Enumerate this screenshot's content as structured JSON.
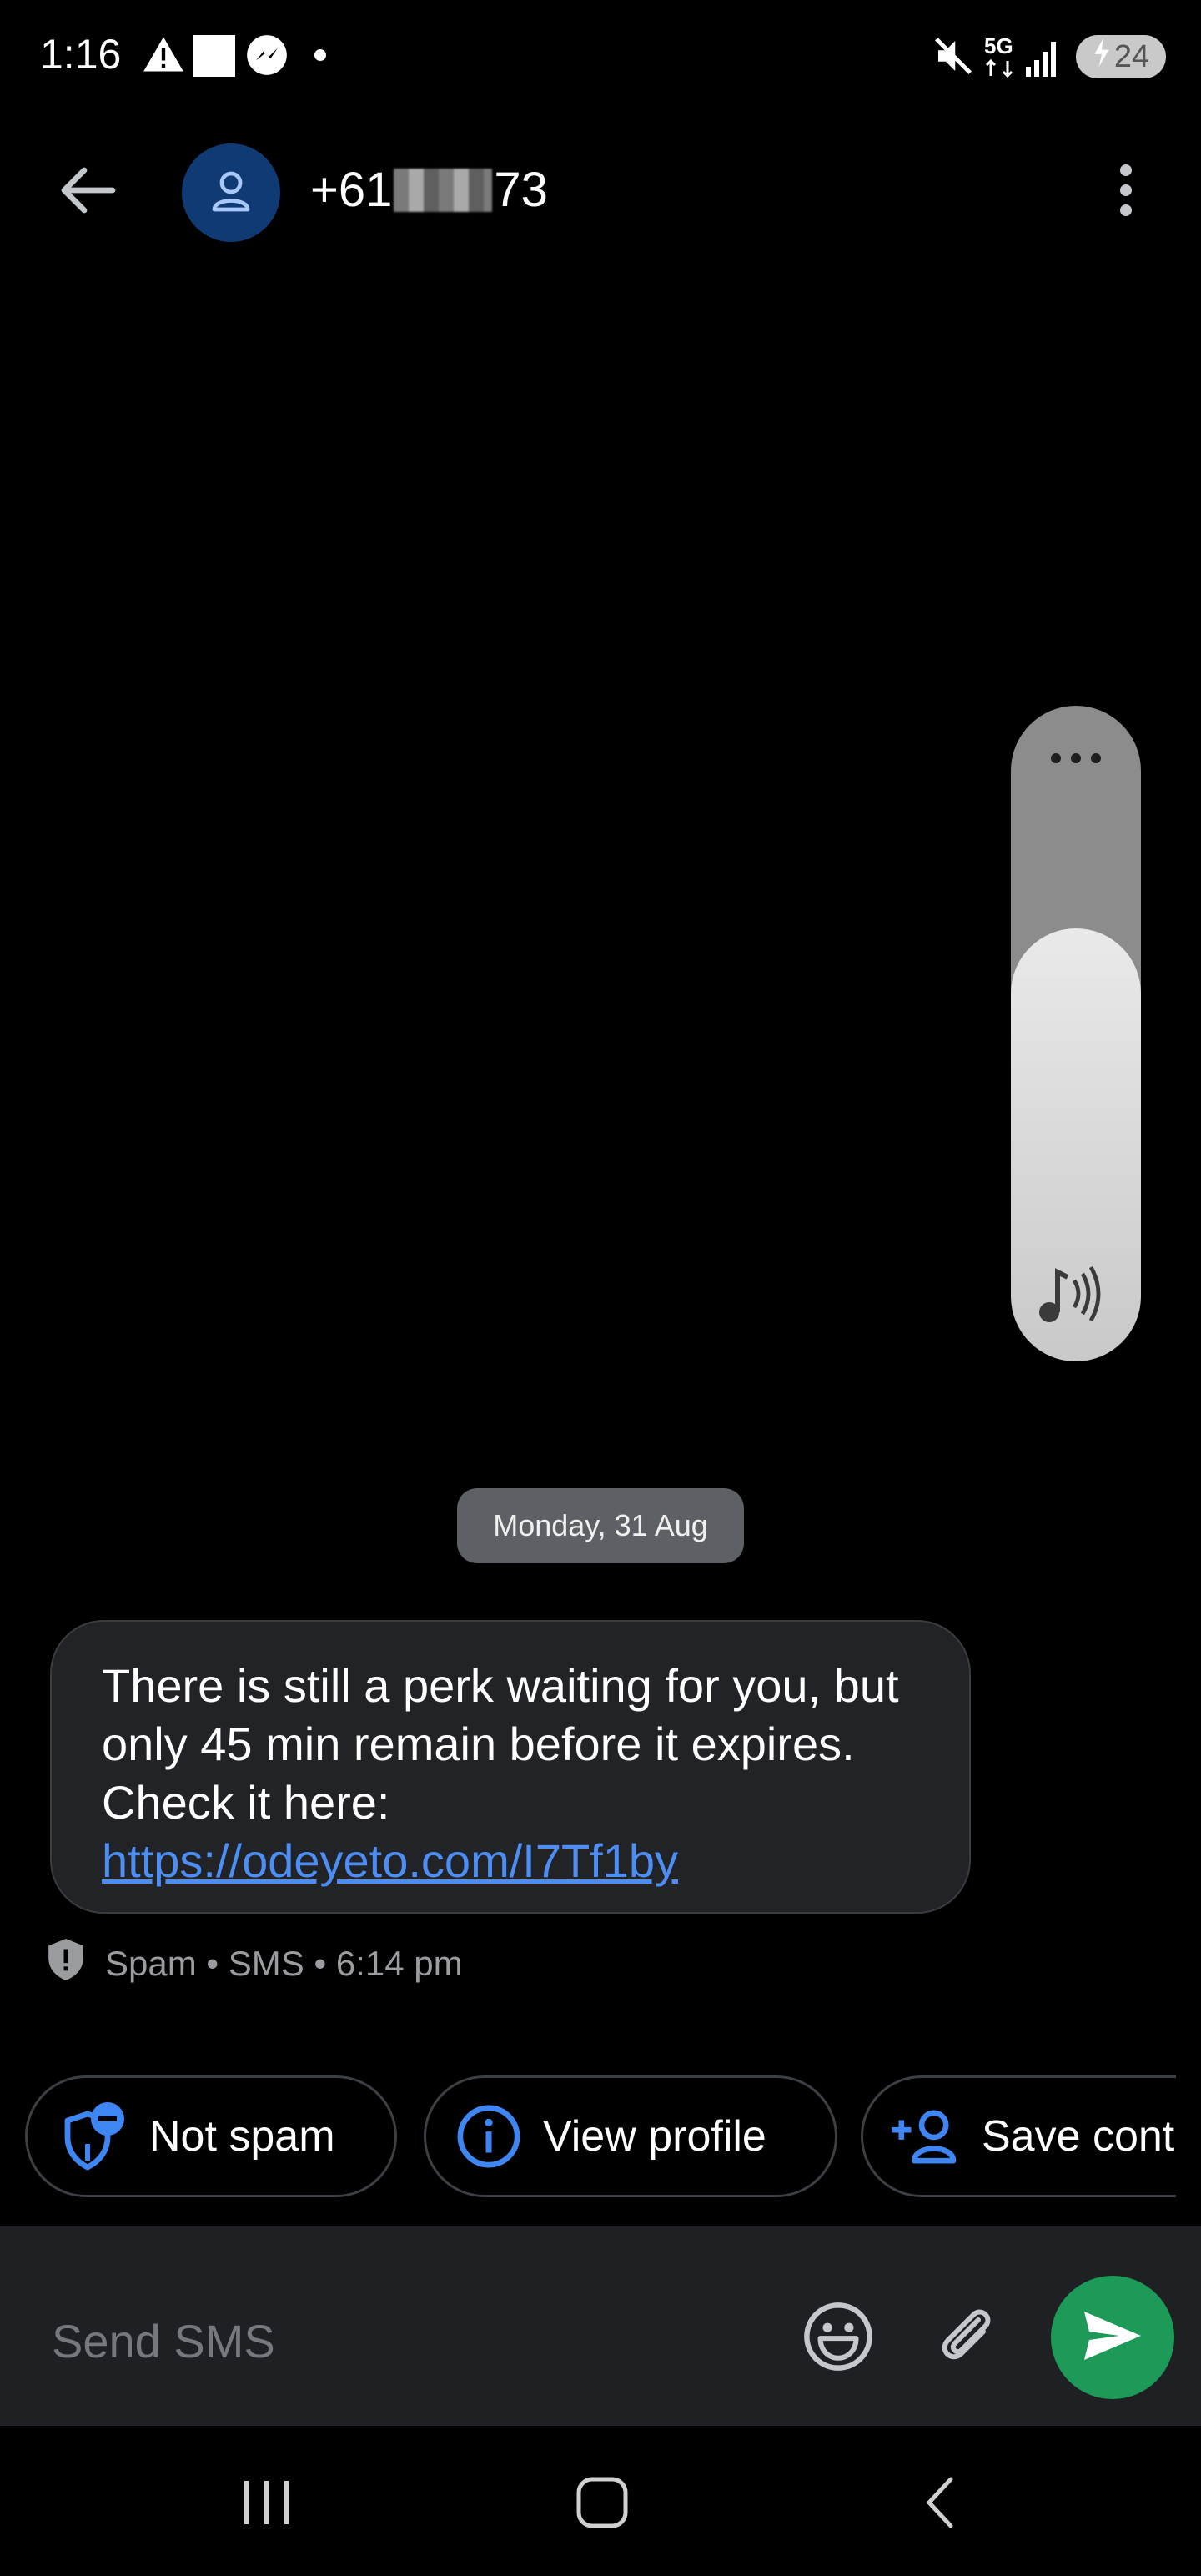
{
  "status_bar": {
    "time": "1:16",
    "network_label": "5G",
    "battery_level": "24",
    "icons": [
      "warning-icon",
      "white-square-icon",
      "messenger-icon",
      "dot-icon",
      "mute-icon",
      "5g-icon",
      "signal-icon",
      "battery-charging-icon"
    ]
  },
  "header": {
    "number_prefix": "+61",
    "number_suffix": "73",
    "back_icon": "arrow-left-icon",
    "avatar_icon": "person-icon",
    "menu_icon": "more-vertical-icon"
  },
  "volume": {
    "level_fraction": 0.66,
    "more_icon": "more-horizontal-icon",
    "icon": "music-volume-icon"
  },
  "conversation": {
    "date_label": "Monday, 31 Aug",
    "message": {
      "text": "There is still a perk waiting for you, but only 45 min remain before it expires. Check it here:",
      "link": "https://odeyeto.com/I7Tf1by"
    },
    "meta": {
      "icon": "spam-shield-icon",
      "text": "Spam • SMS • 6:14 pm"
    }
  },
  "actions": {
    "not_spam": "Not spam",
    "view_profile": "View profile",
    "save_contact": "Save cont"
  },
  "compose": {
    "placeholder": "Send SMS",
    "accent": "#1d9a57"
  },
  "colors": {
    "link": "#4d8ef5",
    "chip_icon": "#3f86f5",
    "avatar_bg": "#0f3a73",
    "bubble_bg": "#212327"
  }
}
